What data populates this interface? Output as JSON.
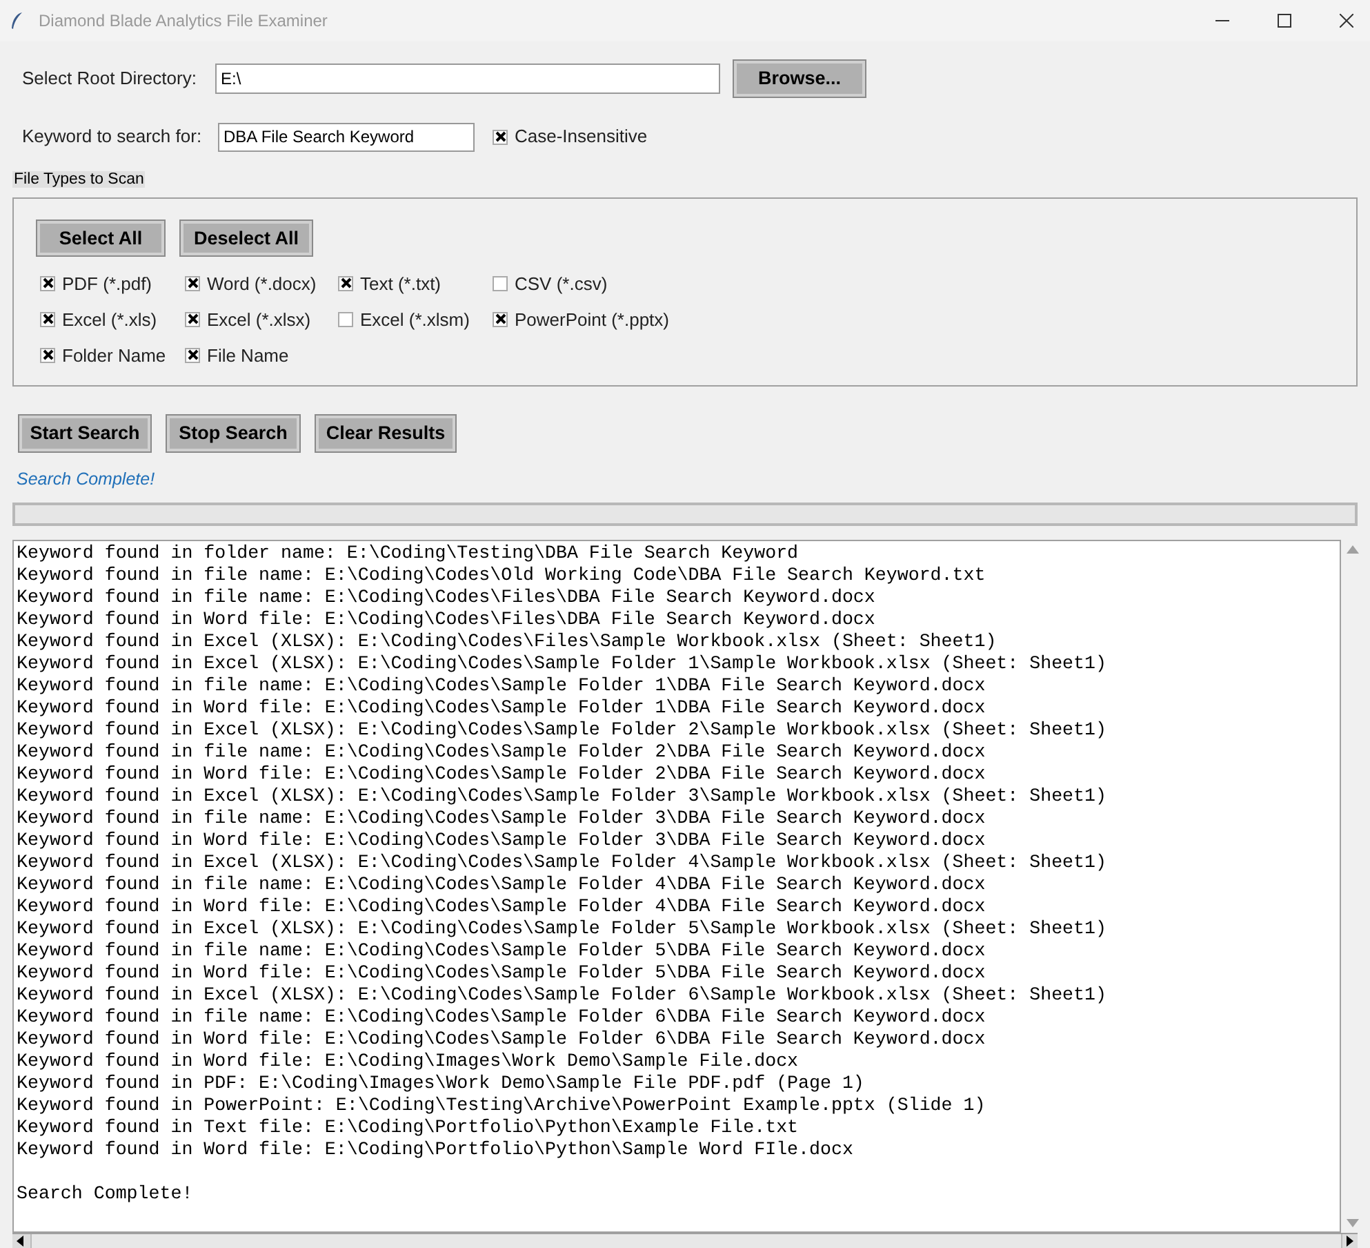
{
  "window": {
    "title": "Diamond Blade Analytics File Examiner"
  },
  "root_directory": {
    "label": "Select Root Directory:",
    "value": "E:\\",
    "browse_button": "Browse..."
  },
  "keyword": {
    "label": "Keyword to search for:",
    "value": "DBA File Search Keyword",
    "case_insensitive": {
      "label": "Case-Insensitive",
      "checked": true
    }
  },
  "file_types": {
    "title": "File Types to Scan",
    "buttons": [
      "Select All",
      "Deselect All"
    ],
    "rows": [
      [
        {
          "label": "PDF (*.pdf)",
          "checked": true
        },
        {
          "label": "Word (*.docx)",
          "checked": true
        },
        {
          "label": "Text (*.txt)",
          "checked": true
        },
        {
          "label": "CSV (*.csv)",
          "checked": false
        }
      ],
      [
        {
          "label": "Excel (*.xls)",
          "checked": true
        },
        {
          "label": "Excel (*.xlsx)",
          "checked": true
        },
        {
          "label": "Excel (*.xlsm)",
          "checked": false
        },
        {
          "label": "PowerPoint (*.pptx)",
          "checked": true
        }
      ],
      [
        {
          "label": "Folder Name",
          "checked": true
        },
        {
          "label": "File Name",
          "checked": true
        }
      ]
    ]
  },
  "actions": [
    "Start Search",
    "Stop Search",
    "Clear Results"
  ],
  "status": "Search Complete!",
  "progress": {
    "level": 0
  },
  "results": {
    "lines": [
      "Keyword found in folder name: E:\\Coding\\Testing\\DBA File Search Keyword",
      "Keyword found in file name: E:\\Coding\\Codes\\Old Working Code\\DBA File Search Keyword.txt",
      "Keyword found in file name: E:\\Coding\\Codes\\Files\\DBA File Search Keyword.docx",
      "Keyword found in Word file: E:\\Coding\\Codes\\Files\\DBA File Search Keyword.docx",
      "Keyword found in Excel (XLSX): E:\\Coding\\Codes\\Files\\Sample Workbook.xlsx (Sheet: Sheet1)",
      "Keyword found in Excel (XLSX): E:\\Coding\\Codes\\Sample Folder 1\\Sample Workbook.xlsx (Sheet: Sheet1)",
      "Keyword found in file name: E:\\Coding\\Codes\\Sample Folder 1\\DBA File Search Keyword.docx",
      "Keyword found in Word file: E:\\Coding\\Codes\\Sample Folder 1\\DBA File Search Keyword.docx",
      "Keyword found in Excel (XLSX): E:\\Coding\\Codes\\Sample Folder 2\\Sample Workbook.xlsx (Sheet: Sheet1)",
      "Keyword found in file name: E:\\Coding\\Codes\\Sample Folder 2\\DBA File Search Keyword.docx",
      "Keyword found in Word file: E:\\Coding\\Codes\\Sample Folder 2\\DBA File Search Keyword.docx",
      "Keyword found in Excel (XLSX): E:\\Coding\\Codes\\Sample Folder 3\\Sample Workbook.xlsx (Sheet: Sheet1)",
      "Keyword found in file name: E:\\Coding\\Codes\\Sample Folder 3\\DBA File Search Keyword.docx",
      "Keyword found in Word file: E:\\Coding\\Codes\\Sample Folder 3\\DBA File Search Keyword.docx",
      "Keyword found in Excel (XLSX): E:\\Coding\\Codes\\Sample Folder 4\\Sample Workbook.xlsx (Sheet: Sheet1)",
      "Keyword found in file name: E:\\Coding\\Codes\\Sample Folder 4\\DBA File Search Keyword.docx",
      "Keyword found in Word file: E:\\Coding\\Codes\\Sample Folder 4\\DBA File Search Keyword.docx",
      "Keyword found in Excel (XLSX): E:\\Coding\\Codes\\Sample Folder 5\\Sample Workbook.xlsx (Sheet: Sheet1)",
      "Keyword found in file name: E:\\Coding\\Codes\\Sample Folder 5\\DBA File Search Keyword.docx",
      "Keyword found in Word file: E:\\Coding\\Codes\\Sample Folder 5\\DBA File Search Keyword.docx",
      "Keyword found in Excel (XLSX): E:\\Coding\\Codes\\Sample Folder 6\\Sample Workbook.xlsx (Sheet: Sheet1)",
      "Keyword found in file name: E:\\Coding\\Codes\\Sample Folder 6\\DBA File Search Keyword.docx",
      "Keyword found in Word file: E:\\Coding\\Codes\\Sample Folder 6\\DBA File Search Keyword.docx",
      "Keyword found in Word file: E:\\Coding\\Images\\Work Demo\\Sample File.docx",
      "Keyword found in PDF: E:\\Coding\\Images\\Work Demo\\Sample File PDF.pdf (Page 1)",
      "Keyword found in PowerPoint: E:\\Coding\\Testing\\Archive\\PowerPoint Example.pptx (Slide 1)",
      "Keyword found in Text file: E:\\Coding\\Portfolio\\Python\\Example File.txt",
      "Keyword found in Word file: E:\\Coding\\Portfolio\\Python\\Sample Word FIle.docx"
    ],
    "final_message": "Search Complete!"
  }
}
